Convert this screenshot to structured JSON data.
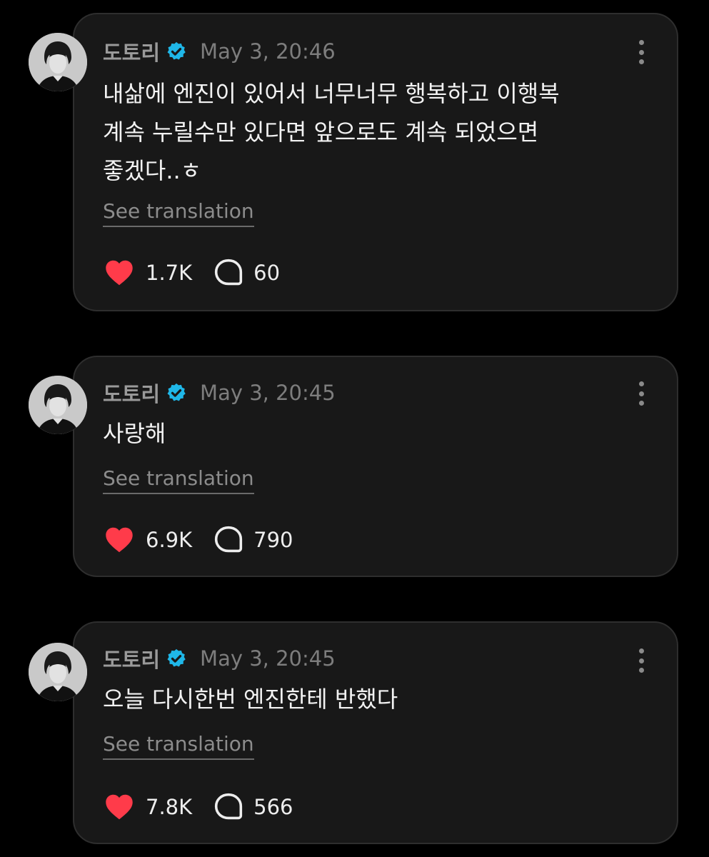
{
  "colors": {
    "background": "#000000",
    "card": "#181818",
    "card_border": "#2e2e2e",
    "like": "#ff3b4a",
    "verified": "#1fb7e8",
    "muted_text": "#7d7d7d"
  },
  "posts": [
    {
      "username": "도토리",
      "verified_icon": "verified-badge-icon",
      "timestamp": "May 3, 20:46",
      "lines": [
        "내삶에 엔진이 있어서 너무너무 행복하고 이행복",
        "계속 누릴수만 있다면 앞으로도 계속 되었으면",
        "좋겠다..ㅎ"
      ],
      "translate_label": "See translation",
      "likes": "1.7K",
      "replies": "60"
    },
    {
      "username": "도토리",
      "verified_icon": "verified-badge-icon",
      "timestamp": "May 3, 20:45",
      "lines": [
        "사랑해"
      ],
      "translate_label": "See translation",
      "likes": "6.9K",
      "replies": "790"
    },
    {
      "username": "도토리",
      "verified_icon": "verified-badge-icon",
      "timestamp": "May 3, 20:45",
      "lines": [
        "오늘 다시한번 엔진한테 반했다"
      ],
      "translate_label": "See translation",
      "likes": "7.8K",
      "replies": "566"
    }
  ]
}
